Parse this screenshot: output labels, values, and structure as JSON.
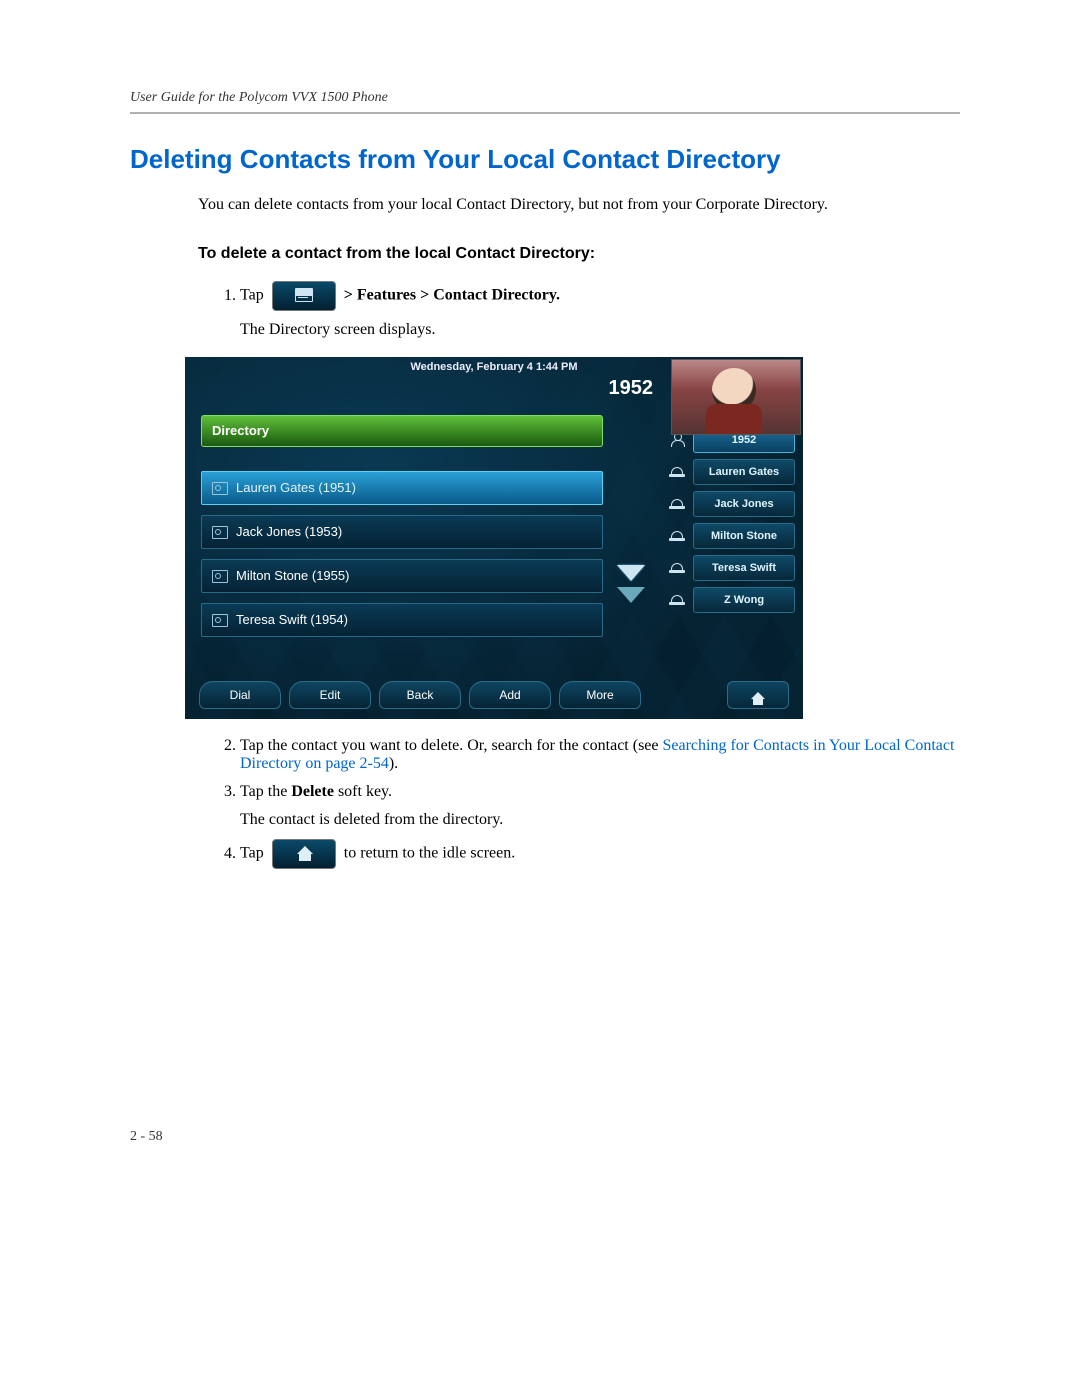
{
  "header": "User Guide for the Polycom VVX 1500 Phone",
  "title": "Deleting Contacts from Your Local Contact Directory",
  "intro": "You can delete contacts from your local Contact Directory, but not from your Corporate Directory.",
  "subhead": "To delete a contact from the local Contact Directory:",
  "step1": {
    "pre": "Tap",
    "post": " > Features > Contact Directory.",
    "after": "The Directory screen displays."
  },
  "screenshot": {
    "datetime": "Wednesday, February 4  1:44 PM",
    "extension": "1952",
    "list_header": "Directory",
    "contacts": [
      {
        "name": "Lauren Gates (1951)",
        "selected": true
      },
      {
        "name": "Jack Jones (1953)",
        "selected": false
      },
      {
        "name": "Milton Stone (1955)",
        "selected": false
      },
      {
        "name": "Teresa Swift (1954)",
        "selected": false
      }
    ],
    "softkeys": [
      "Dial",
      "Edit",
      "Back",
      "Add",
      "More"
    ],
    "side": [
      "1952",
      "Lauren Gates",
      "Jack Jones",
      "Milton Stone",
      "Teresa Swift",
      "Z Wong"
    ]
  },
  "step2": {
    "text": "Tap the contact you want to delete. Or, search for the contact (see ",
    "link": "Searching for Contacts in Your Local Contact Directory",
    "link_suffix": " on page 2-54",
    "close": ")."
  },
  "step3": {
    "pre": "Tap the ",
    "bold": "Delete",
    "post": " soft key.",
    "after": "The contact is deleted from the directory."
  },
  "step4": {
    "pre": "Tap",
    "post": "to return to the idle screen."
  },
  "page_num": "2 - 58"
}
